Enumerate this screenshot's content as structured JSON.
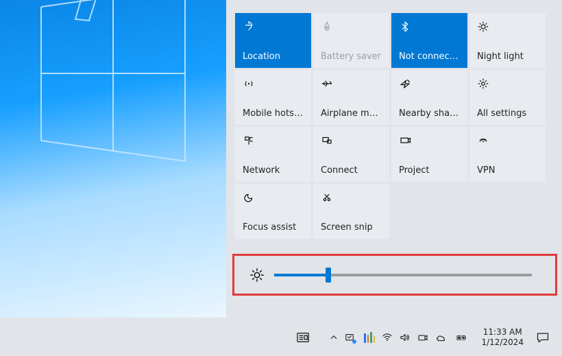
{
  "tiles": {
    "location": {
      "label": "Location",
      "icon": "location-icon",
      "active": true,
      "disabled": false
    },
    "battery_saver": {
      "label": "Battery saver",
      "icon": "battery-saver-icon",
      "active": false,
      "disabled": true
    },
    "bluetooth": {
      "label": "Not connected",
      "icon": "bluetooth-icon",
      "active": true,
      "disabled": false
    },
    "night_light": {
      "label": "Night light",
      "icon": "night-light-icon",
      "active": false,
      "disabled": false
    },
    "mobile_hotspot": {
      "label": "Mobile hotspot",
      "icon": "hotspot-icon",
      "active": false,
      "disabled": false
    },
    "airplane_mode": {
      "label": "Airplane mode",
      "icon": "airplane-icon",
      "active": false,
      "disabled": false
    },
    "nearby_sharing": {
      "label": "Nearby sharing",
      "icon": "nearby-share-icon",
      "active": false,
      "disabled": false
    },
    "all_settings": {
      "label": "All settings",
      "icon": "settings-icon",
      "active": false,
      "disabled": false
    },
    "network": {
      "label": "Network",
      "icon": "network-icon",
      "active": false,
      "disabled": false
    },
    "connect": {
      "label": "Connect",
      "icon": "connect-icon",
      "active": false,
      "disabled": false
    },
    "project": {
      "label": "Project",
      "icon": "project-icon",
      "active": false,
      "disabled": false
    },
    "vpn": {
      "label": "VPN",
      "icon": "vpn-icon",
      "active": false,
      "disabled": false
    },
    "focus_assist": {
      "label": "Focus assist",
      "icon": "focus-assist-icon",
      "active": false,
      "disabled": false
    },
    "screen_snip": {
      "label": "Screen snip",
      "icon": "screen-snip-icon",
      "active": false,
      "disabled": false
    }
  },
  "brightness": {
    "value_percent": 21
  },
  "taskbar": {
    "time": "11:33 AM",
    "date": "1/12/2024"
  },
  "highlight_color": "#e03b3b",
  "accent_color": "#0078d4",
  "annotation": "Brightness slider highlighted with red rectangle"
}
